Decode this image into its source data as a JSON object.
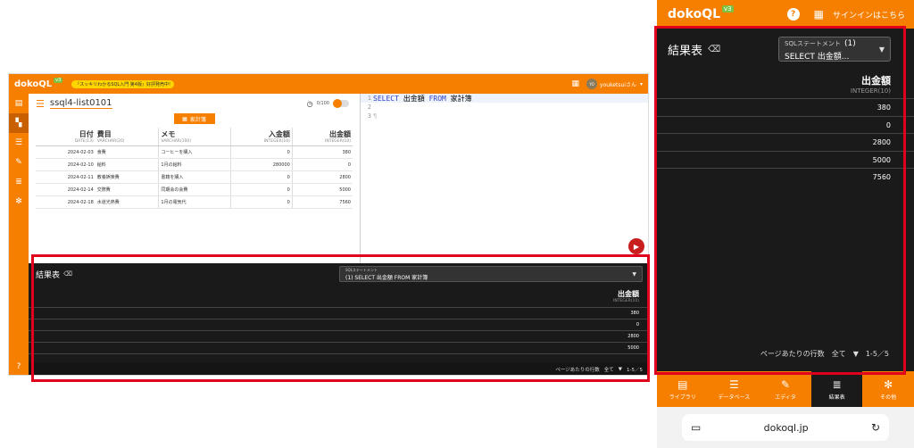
{
  "desktop": {
    "logo": "dokoQL",
    "version": "v3",
    "promo": "『スッキリわかるSQL入門 第4版』好評発売中!",
    "grid_icon": "grid-icon",
    "user": {
      "initials": "YO",
      "name": "youketsuiさん"
    },
    "library": {
      "name": "ssql4-list0101",
      "count": "0/100",
      "tab": "家計簿",
      "columns": [
        {
          "name": "日付",
          "type": "DATE(13)"
        },
        {
          "name": "費目",
          "type": "VARCHAR(20)"
        },
        {
          "name": "メモ",
          "type": "VARCHAR(100)"
        },
        {
          "name": "入金額",
          "type": "INTEGER(10)"
        },
        {
          "name": "出金額",
          "type": "INTEGER(10)"
        }
      ],
      "rows": [
        [
          "2024-02-03",
          "食費",
          "コーヒーを購入",
          "0",
          "380"
        ],
        [
          "2024-02-10",
          "給料",
          "1月の給料",
          "280000",
          "0"
        ],
        [
          "2024-02-11",
          "教養娯楽費",
          "書籍を購入",
          "0",
          "2800"
        ],
        [
          "2024-02-14",
          "交際費",
          "同期会の会費",
          "0",
          "5000"
        ],
        [
          "2024-02-18",
          "水道光熱費",
          "1月の電気代",
          "0",
          "7560"
        ]
      ]
    },
    "editor": {
      "line_numbers": [
        "1",
        "2",
        "3"
      ],
      "kw_select": "SELECT",
      "col": "出金額",
      "kw_from": "FROM",
      "table": "家計簿",
      "pilcrow": "¶"
    },
    "result": {
      "title": "結果表",
      "sql_label": "SQLステートメント",
      "sql_value": "(1) SELECT 出金額 FROM 家計簿",
      "header_name": "出金額",
      "header_type": "INTEGER(10)",
      "values": [
        "380",
        "0",
        "2800",
        "5000"
      ],
      "rows_per_page_label": "ページあたりの行数",
      "rows_per_page_value": "全て",
      "range": "1-5／5"
    }
  },
  "mobile": {
    "logo": "dokoQL",
    "version": "v3",
    "help": "?",
    "signin": "サインインはこちら",
    "result": {
      "title": "結果表",
      "sql_label": "SQLステートメント",
      "sql_value": "(1) SELECT 出金額...",
      "header_name": "出金額",
      "header_type": "INTEGER(10)",
      "values": [
        "380",
        "0",
        "2800",
        "5000",
        "7560"
      ],
      "rows_per_page_label": "ページあたりの行数",
      "rows_per_page_value": "全て",
      "range": "1-5／5"
    },
    "nav": [
      {
        "label": "ライブラリ",
        "icon": "book-icon"
      },
      {
        "label": "データベース",
        "icon": "database-icon"
      },
      {
        "label": "エディタ",
        "icon": "pencil-icon"
      },
      {
        "label": "結果表",
        "icon": "table-icon"
      },
      {
        "label": "その他",
        "icon": "gear-icon"
      }
    ],
    "url": "dokoql.jp"
  },
  "colors": {
    "accent": "#f77f00",
    "dark": "#1a1a1a",
    "highlight": "#e0001b",
    "version_badge": "#7cc242"
  }
}
